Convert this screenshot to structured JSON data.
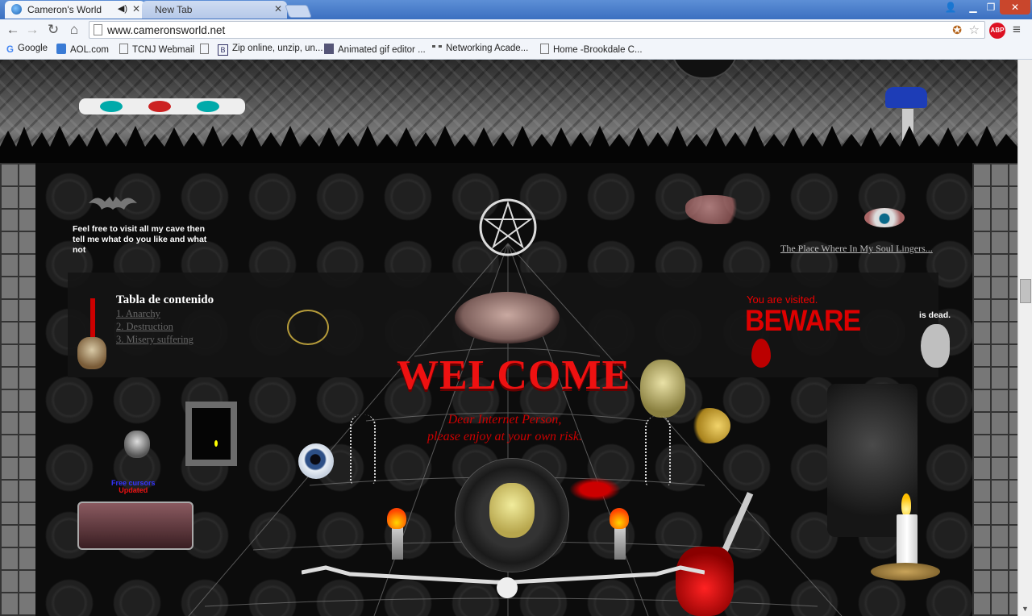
{
  "browser": {
    "tabs": [
      {
        "title": "Cameron's World",
        "active": true
      },
      {
        "title": "New Tab",
        "active": false
      }
    ],
    "url": "www.cameronsworld.net",
    "bookmarks": [
      {
        "label": "Google",
        "icon": "google-icon"
      },
      {
        "label": "AOL.com",
        "icon": "aol-icon"
      },
      {
        "label": "TCNJ Webmail",
        "icon": "page-icon"
      },
      {
        "label": "",
        "icon": "page-icon"
      },
      {
        "label": "Zip online, unzip, un...",
        "icon": "b-icon"
      },
      {
        "label": "Animated gif editor ...",
        "icon": "gif-icon"
      },
      {
        "label": "Networking Acade...",
        "icon": "cisco-icon"
      },
      {
        "label": "Home -Brookdale C...",
        "icon": "page-icon"
      }
    ],
    "extensions": {
      "abp_label": "ABP"
    }
  },
  "page": {
    "feel_free": "Feel free to visit all my cave then tell me what do you like and what not",
    "soul_link": "The Place Where In My Soul Lingers...",
    "toc": {
      "title": "Tabla de contenido",
      "items": [
        "1. Anarchy",
        "2. Destruction",
        "3. Misery suffering"
      ]
    },
    "visited": "You are visited.",
    "beware": "BEWARE",
    "is_dead": "is dead.",
    "welcome": "WELCOME",
    "dear_line1": "Dear Internet Person,",
    "dear_line2": "please enjoy at your own risk.",
    "free_cursors": "Free cursors",
    "updated": "Updated",
    "colors": {
      "accent_red": "#e11111",
      "link_gray": "#666666"
    }
  }
}
